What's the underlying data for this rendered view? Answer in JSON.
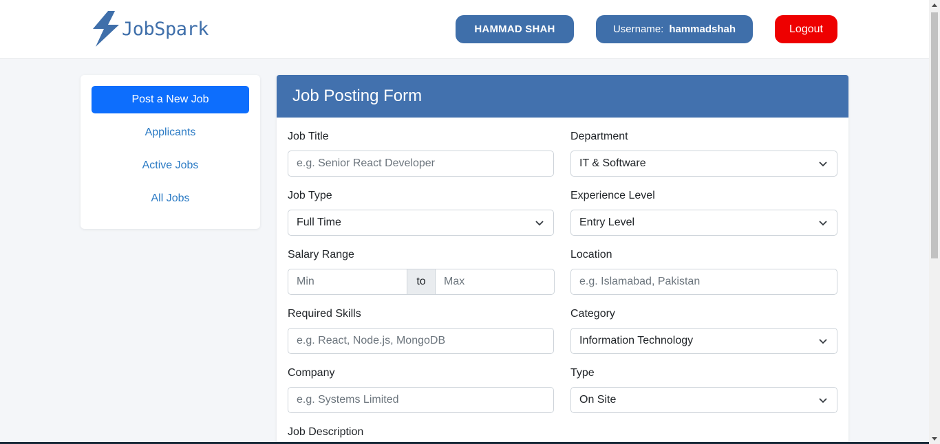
{
  "brand": {
    "name": "JobSpark",
    "color": "#3f6faa",
    "icon": "lightning-bolt-icon"
  },
  "header": {
    "user_name": "HAMMAD SHAH",
    "username_label": "Username:",
    "username_value": "hammadshah",
    "logout_label": "Logout"
  },
  "sidebar": {
    "primary_button": "Post a New Job",
    "links": [
      "Applicants",
      "Active Jobs",
      "All Jobs"
    ]
  },
  "form": {
    "title": "Job Posting Form",
    "job_title": {
      "label": "Job Title",
      "placeholder": "e.g. Senior React Developer"
    },
    "department": {
      "label": "Department",
      "value": "IT & Software"
    },
    "job_type": {
      "label": "Job Type",
      "value": "Full Time"
    },
    "experience": {
      "label": "Experience Level",
      "value": "Entry Level"
    },
    "salary": {
      "label": "Salary Range",
      "min_placeholder": "Min",
      "to": "to",
      "max_placeholder": "Max"
    },
    "location": {
      "label": "Location",
      "placeholder": "e.g. Islamabad, Pakistan"
    },
    "skills": {
      "label": "Required Skills",
      "placeholder": "e.g. React, Node.js, MongoDB"
    },
    "category": {
      "label": "Category",
      "value": "Information Technology"
    },
    "company": {
      "label": "Company",
      "placeholder": "e.g. Systems Limited"
    },
    "type": {
      "label": "Type",
      "value": "On Site"
    },
    "description": {
      "label": "Job Description"
    }
  },
  "colors": {
    "header_blue": "#4271ae",
    "primary": "#0d6efd",
    "logout_red": "#ee0000",
    "link": "#2a7ac4"
  }
}
